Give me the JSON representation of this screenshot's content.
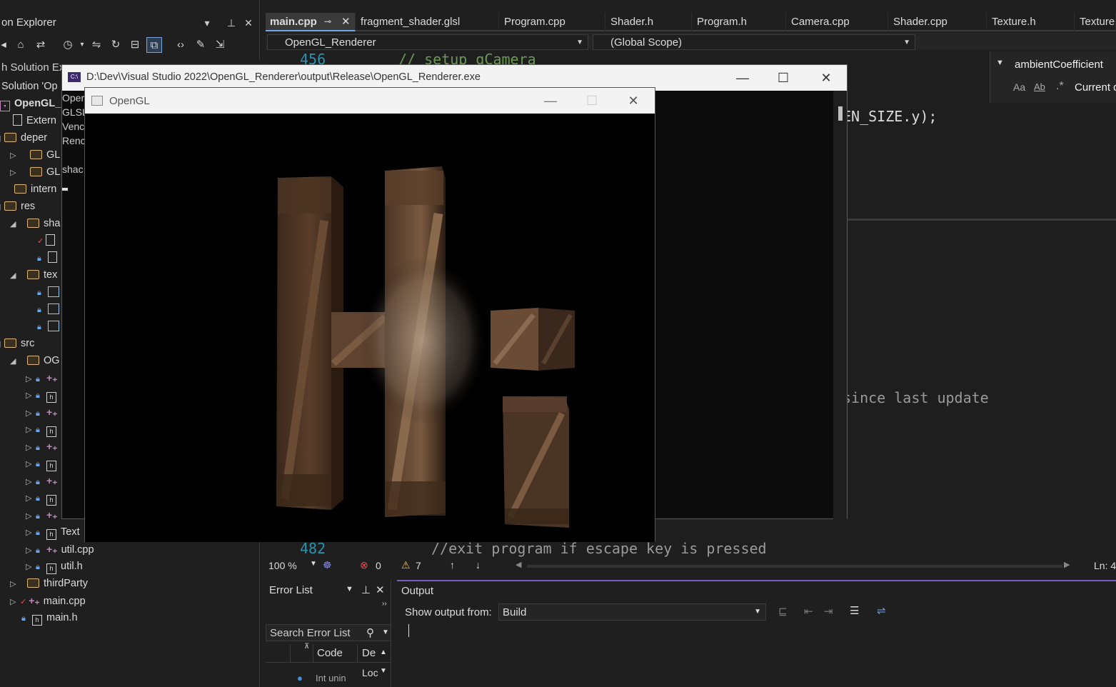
{
  "solution_explorer": {
    "title": "on Explorer",
    "search_text": "h Solution Ex",
    "solution_label": "Solution 'Op",
    "project_label": "OpenGL_",
    "items": [
      {
        "label": "Extern"
      },
      {
        "label": "deper"
      },
      {
        "label": "GL"
      },
      {
        "label": "GL"
      },
      {
        "label": "intern"
      },
      {
        "label": "res"
      },
      {
        "label": "sha"
      },
      {
        "label": "tex"
      },
      {
        "label": "src"
      },
      {
        "label": "OG"
      },
      {
        "label": "Text"
      },
      {
        "label": "util.cpp"
      },
      {
        "label": "util.h"
      },
      {
        "label": "thirdParty"
      },
      {
        "label": "main.cpp"
      },
      {
        "label": "main.h"
      }
    ]
  },
  "tabs": [
    {
      "label": "main.cpp"
    },
    {
      "label": "fragment_shader.glsl"
    },
    {
      "label": "Program.cpp"
    },
    {
      "label": "Shader.h"
    },
    {
      "label": "Program.h"
    },
    {
      "label": "Camera.cpp"
    },
    {
      "label": "Shader.cpp"
    },
    {
      "label": "Texture.h"
    },
    {
      "label": "Texture."
    }
  ],
  "nav": {
    "project": "OpenGL_Renderer",
    "scope": "(Global Scope)"
  },
  "find": {
    "query": "ambientCoefficient",
    "current": "Current d"
  },
  "code": {
    "line_top_num": "456",
    "line_top": "// setup gCamera",
    "line_a": "EN_SIZE.y);",
    "line_b": "since last update",
    "line_bottom_num": "482",
    "line_bottom": "//exit program if escape key is pressed"
  },
  "status": {
    "zoom": "100 %",
    "errors": "0",
    "warnings": "7",
    "position": "Ln: 4"
  },
  "error_list": {
    "title": "Error List",
    "search_placeholder": "Search Error List",
    "col_code": "Code",
    "col_desc": "De",
    "row_text": "Int unin",
    "col_loc": "Loc"
  },
  "output": {
    "title": "Output",
    "show_from_label": "Show output from:",
    "source": "Build"
  },
  "console": {
    "title": "D:\\Dev\\Visual Studio 2022\\OpenGL_Renderer\\output\\Release\\OpenGL_Renderer.exe",
    "lines": [
      "Oper",
      "GLSL",
      "Venc",
      "Renc",
      "shac"
    ]
  },
  "gl_window": {
    "title": "OpenGL"
  }
}
